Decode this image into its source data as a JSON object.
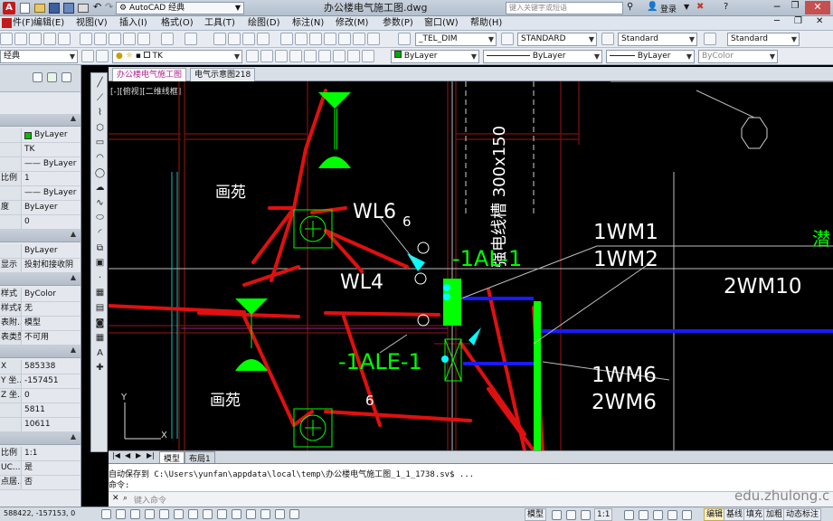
{
  "titlebar": {
    "app_name": "AutoCAD 经典",
    "file_title": "办公楼电气施工图.dwg",
    "search_placeholder": "键入关键字或短语",
    "login_label": "登录"
  },
  "menu": [
    "件(F)",
    "编辑(E)",
    "视图(V)",
    "插入(I)",
    "格式(O)",
    "工具(T)",
    "绘图(D)",
    "标注(N)",
    "修改(M)",
    "参数(P)",
    "窗口(W)",
    "帮助(H)"
  ],
  "toolbar1": {
    "text_style": "_TEL_DIM",
    "dim_style": "STANDARD",
    "table_style": "Standard",
    "multileader_style": "Standard"
  },
  "toolbar2": {
    "workspace": "经典",
    "layer": "TK",
    "color": "ByLayer",
    "linetype": "ByLayer",
    "lineweight": "ByLayer",
    "plotstyle": "ByColor"
  },
  "properties": {
    "rows": [
      {
        "k": "",
        "v": "ByLayer"
      },
      {
        "k": "",
        "v": "TK"
      },
      {
        "k": "",
        "v": "—— ByLayer"
      },
      {
        "k": "比例",
        "v": "1"
      },
      {
        "k": "",
        "v": "—— ByLayer"
      },
      {
        "k": "度",
        "v": "ByLayer"
      },
      {
        "k": "",
        "v": "0"
      },
      {
        "k": "",
        "v": "ByLayer"
      },
      {
        "k": "显示",
        "v": "投射和接收阴"
      },
      {
        "k": "样式",
        "v": "ByColor"
      },
      {
        "k": "样式表",
        "v": "无"
      },
      {
        "k": "表附...",
        "v": "模型"
      },
      {
        "k": "表类型",
        "v": "不可用"
      },
      {
        "k": "X",
        "v": "585338"
      },
      {
        "k": "Y 坐...",
        "v": "-157451"
      },
      {
        "k": "Z 坐...",
        "v": "0"
      },
      {
        "k": "",
        "v": "5811"
      },
      {
        "k": "",
        "v": "10611"
      },
      {
        "k": "比例",
        "v": "1:1"
      },
      {
        "k": "UC...",
        "v": "是"
      },
      {
        "k": "点居...",
        "v": "否"
      }
    ]
  },
  "doc_tabs": [
    "办公楼电气施工图",
    "电气示意图218"
  ],
  "viewport_label": "[-][俯视][二维线框]",
  "drawing": {
    "room_label_1": "画苑",
    "room_label_2": "画苑",
    "wl6": "WL6",
    "wl4": "WL4",
    "n6a": "6",
    "n6b": "6",
    "trunking": "强电线槽 300x150",
    "panel_al": "-1AL-1",
    "panel_ale": "-1ALE-1",
    "wm1": "1WM1",
    "wm2": "1WM2",
    "wm10": "2WM10",
    "wm6a": "1WM6",
    "wm6b": "2WM6",
    "edge_text": "潜",
    "ucs_y": "Y",
    "ucs_x": "X"
  },
  "layout_tabs": [
    "模型",
    "布局1"
  ],
  "command": {
    "line1": "自动保存到 C:\\Users\\yunfan\\appdata\\local\\temp\\办公楼电气施工图_1_1_1738.sv$ ...",
    "line2": "命令:",
    "prompt_placeholder": "键入命令"
  },
  "status": {
    "coords": "588422, -157153, 0",
    "model": "模型",
    "scale": "1:1",
    "buttons": [
      "编辑",
      "基线",
      "填充",
      "加粗",
      "动态标注"
    ]
  },
  "watermark": "edu.zhulong.c",
  "colors": {
    "red": "#e01010",
    "green": "#00ff00",
    "blue": "#1a1aff",
    "cyan": "#00ffff",
    "white": "#ffffff"
  }
}
